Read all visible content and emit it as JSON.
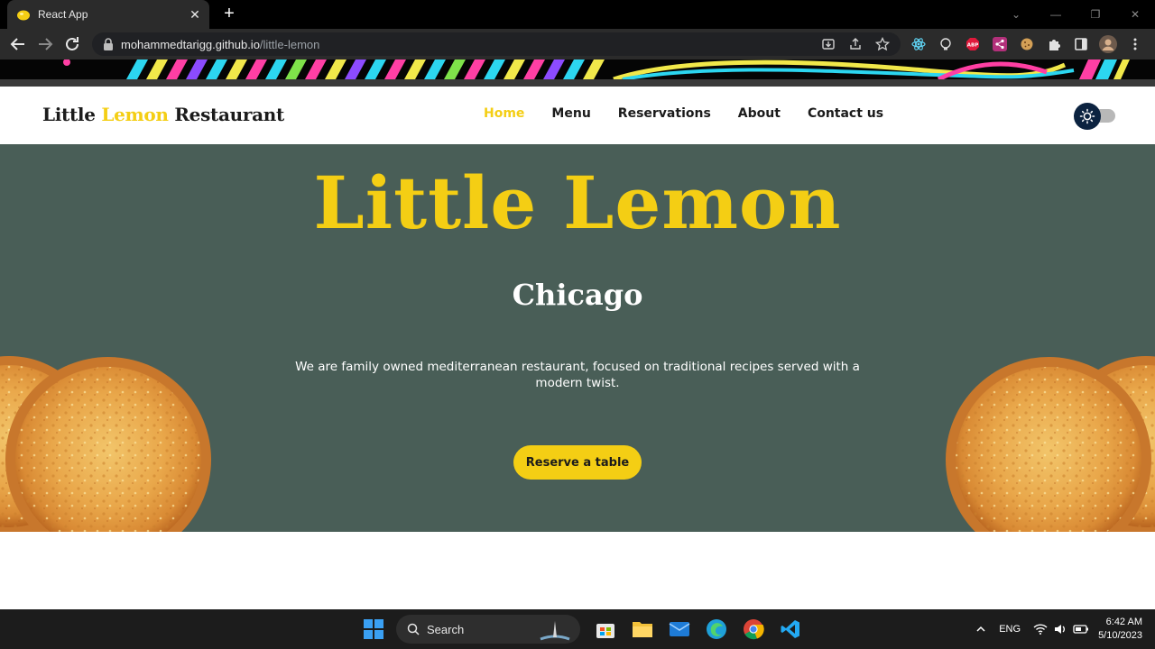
{
  "browser": {
    "tab_title": "React App",
    "tab_close": "✕",
    "new_tab": "+",
    "url_host": "mohammedtarigg.github.io",
    "url_path": "/little-lemon"
  },
  "site": {
    "brand": {
      "part1": "Little ",
      "part2": "Lemon",
      "part3": " Restaurant"
    },
    "nav": [
      {
        "label": "Home",
        "active": true
      },
      {
        "label": "Menu"
      },
      {
        "label": "Reservations"
      },
      {
        "label": "About"
      },
      {
        "label": "Contact us"
      }
    ],
    "theme_toggle": {
      "state": "light",
      "icon": "sun-icon"
    }
  },
  "hero": {
    "title": "Little Lemon",
    "city": "Chicago",
    "description": "We are family owned mediterranean restaurant, focused on traditional recipes served with a modern twist.",
    "cta": "Reserve a table"
  },
  "taskbar": {
    "search_label": "Search",
    "language": "ENG",
    "time": "6:42 AM",
    "date": "5/10/2023"
  },
  "colors": {
    "hero_bg": "#495e57",
    "accent_yellow": "#f4ce14",
    "text_dark": "#1b1b1b"
  }
}
